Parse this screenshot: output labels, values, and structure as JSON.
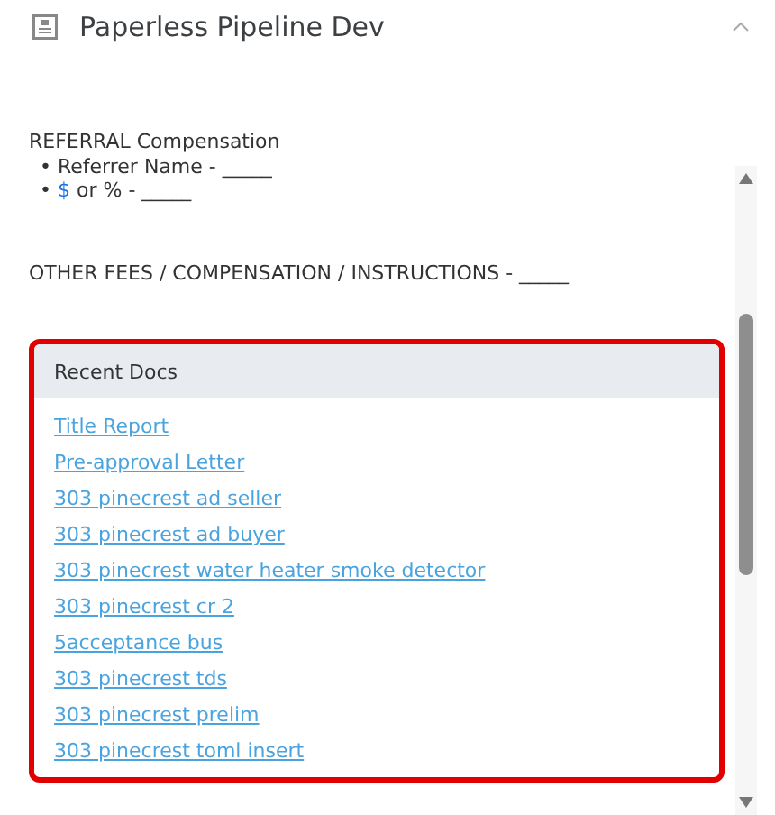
{
  "header": {
    "title": "Paperless Pipeline Dev",
    "expanded": true
  },
  "notes": {
    "heading": "REFERRAL Compensation",
    "bullets": [
      {
        "parts": [
          {
            "kind": "plain",
            "text": "• Referrer Name - _____"
          }
        ]
      },
      {
        "parts": [
          {
            "kind": "plain",
            "text": "• "
          },
          {
            "kind": "accent",
            "text": "$"
          },
          {
            "kind": "plain",
            "text": " or % - _____"
          }
        ]
      }
    ],
    "other": "OTHER FEES / COMPENSATION / INSTRUCTIONS - _____"
  },
  "recent_docs": {
    "title": "Recent Docs",
    "highlighted": true,
    "links": [
      "Title Report",
      "Pre-approval Letter",
      "303 pinecrest ad seller",
      "303 pinecrest ad buyer",
      "303 pinecrest water heater smoke detector",
      "303 pinecrest cr 2",
      "5acceptance bus",
      "303 pinecrest tds",
      "303 pinecrest prelim",
      "303 pinecrest toml insert"
    ]
  }
}
